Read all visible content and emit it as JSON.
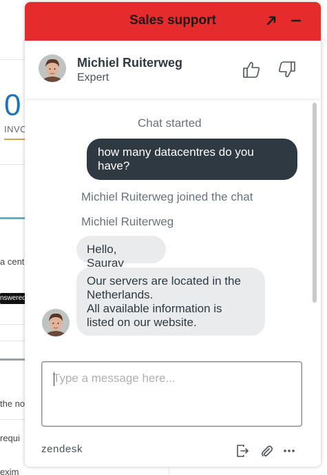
{
  "background": {
    "big_number": "0",
    "label": "INVO",
    "row_text_1": "a cent",
    "badge": "nswered",
    "row_text_2": "the no",
    "row_text_3": "requi",
    "row_text_4": "exim"
  },
  "widget": {
    "title": "Sales support",
    "accent_color": "#e52b2b",
    "header_actions": [
      "popout-icon",
      "minimize-icon"
    ]
  },
  "agent": {
    "name": "Michiel Ruiterweg",
    "title": "Expert"
  },
  "chat": {
    "started": "Chat started",
    "visitor_message": "how many datacentres do you have?",
    "joined": "Michiel Ruiterweg joined the chat",
    "sender_label": "Michiel Ruiterweg",
    "agent_message_1": "Hello, Saurav",
    "agent_message_2_line1": "Our servers are located in the",
    "agent_message_2_line2": "Netherlands.",
    "agent_message_2_line3": "All available information is",
    "agent_message_2_line4": "listed on our website."
  },
  "composer": {
    "placeholder": "Type a message here..."
  },
  "footer": {
    "brand": "zendesk",
    "actions": [
      "end-chat-icon",
      "attach-icon",
      "more-icon"
    ]
  }
}
